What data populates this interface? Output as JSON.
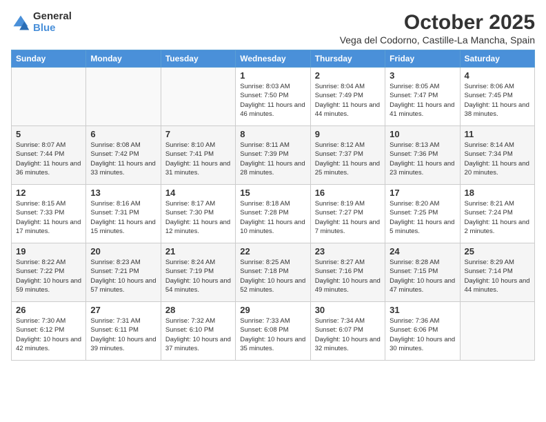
{
  "logo": {
    "general": "General",
    "blue": "Blue"
  },
  "header": {
    "month": "October 2025",
    "location": "Vega del Codorno, Castille-La Mancha, Spain"
  },
  "weekdays": [
    "Sunday",
    "Monday",
    "Tuesday",
    "Wednesday",
    "Thursday",
    "Friday",
    "Saturday"
  ],
  "weeks": [
    [
      {
        "day": "",
        "info": ""
      },
      {
        "day": "",
        "info": ""
      },
      {
        "day": "",
        "info": ""
      },
      {
        "day": "1",
        "info": "Sunrise: 8:03 AM\nSunset: 7:50 PM\nDaylight: 11 hours and 46 minutes."
      },
      {
        "day": "2",
        "info": "Sunrise: 8:04 AM\nSunset: 7:49 PM\nDaylight: 11 hours and 44 minutes."
      },
      {
        "day": "3",
        "info": "Sunrise: 8:05 AM\nSunset: 7:47 PM\nDaylight: 11 hours and 41 minutes."
      },
      {
        "day": "4",
        "info": "Sunrise: 8:06 AM\nSunset: 7:45 PM\nDaylight: 11 hours and 38 minutes."
      }
    ],
    [
      {
        "day": "5",
        "info": "Sunrise: 8:07 AM\nSunset: 7:44 PM\nDaylight: 11 hours and 36 minutes."
      },
      {
        "day": "6",
        "info": "Sunrise: 8:08 AM\nSunset: 7:42 PM\nDaylight: 11 hours and 33 minutes."
      },
      {
        "day": "7",
        "info": "Sunrise: 8:10 AM\nSunset: 7:41 PM\nDaylight: 11 hours and 31 minutes."
      },
      {
        "day": "8",
        "info": "Sunrise: 8:11 AM\nSunset: 7:39 PM\nDaylight: 11 hours and 28 minutes."
      },
      {
        "day": "9",
        "info": "Sunrise: 8:12 AM\nSunset: 7:37 PM\nDaylight: 11 hours and 25 minutes."
      },
      {
        "day": "10",
        "info": "Sunrise: 8:13 AM\nSunset: 7:36 PM\nDaylight: 11 hours and 23 minutes."
      },
      {
        "day": "11",
        "info": "Sunrise: 8:14 AM\nSunset: 7:34 PM\nDaylight: 11 hours and 20 minutes."
      }
    ],
    [
      {
        "day": "12",
        "info": "Sunrise: 8:15 AM\nSunset: 7:33 PM\nDaylight: 11 hours and 17 minutes."
      },
      {
        "day": "13",
        "info": "Sunrise: 8:16 AM\nSunset: 7:31 PM\nDaylight: 11 hours and 15 minutes."
      },
      {
        "day": "14",
        "info": "Sunrise: 8:17 AM\nSunset: 7:30 PM\nDaylight: 11 hours and 12 minutes."
      },
      {
        "day": "15",
        "info": "Sunrise: 8:18 AM\nSunset: 7:28 PM\nDaylight: 11 hours and 10 minutes."
      },
      {
        "day": "16",
        "info": "Sunrise: 8:19 AM\nSunset: 7:27 PM\nDaylight: 11 hours and 7 minutes."
      },
      {
        "day": "17",
        "info": "Sunrise: 8:20 AM\nSunset: 7:25 PM\nDaylight: 11 hours and 5 minutes."
      },
      {
        "day": "18",
        "info": "Sunrise: 8:21 AM\nSunset: 7:24 PM\nDaylight: 11 hours and 2 minutes."
      }
    ],
    [
      {
        "day": "19",
        "info": "Sunrise: 8:22 AM\nSunset: 7:22 PM\nDaylight: 10 hours and 59 minutes."
      },
      {
        "day": "20",
        "info": "Sunrise: 8:23 AM\nSunset: 7:21 PM\nDaylight: 10 hours and 57 minutes."
      },
      {
        "day": "21",
        "info": "Sunrise: 8:24 AM\nSunset: 7:19 PM\nDaylight: 10 hours and 54 minutes."
      },
      {
        "day": "22",
        "info": "Sunrise: 8:25 AM\nSunset: 7:18 PM\nDaylight: 10 hours and 52 minutes."
      },
      {
        "day": "23",
        "info": "Sunrise: 8:27 AM\nSunset: 7:16 PM\nDaylight: 10 hours and 49 minutes."
      },
      {
        "day": "24",
        "info": "Sunrise: 8:28 AM\nSunset: 7:15 PM\nDaylight: 10 hours and 47 minutes."
      },
      {
        "day": "25",
        "info": "Sunrise: 8:29 AM\nSunset: 7:14 PM\nDaylight: 10 hours and 44 minutes."
      }
    ],
    [
      {
        "day": "26",
        "info": "Sunrise: 7:30 AM\nSunset: 6:12 PM\nDaylight: 10 hours and 42 minutes."
      },
      {
        "day": "27",
        "info": "Sunrise: 7:31 AM\nSunset: 6:11 PM\nDaylight: 10 hours and 39 minutes."
      },
      {
        "day": "28",
        "info": "Sunrise: 7:32 AM\nSunset: 6:10 PM\nDaylight: 10 hours and 37 minutes."
      },
      {
        "day": "29",
        "info": "Sunrise: 7:33 AM\nSunset: 6:08 PM\nDaylight: 10 hours and 35 minutes."
      },
      {
        "day": "30",
        "info": "Sunrise: 7:34 AM\nSunset: 6:07 PM\nDaylight: 10 hours and 32 minutes."
      },
      {
        "day": "31",
        "info": "Sunrise: 7:36 AM\nSunset: 6:06 PM\nDaylight: 10 hours and 30 minutes."
      },
      {
        "day": "",
        "info": ""
      }
    ]
  ]
}
